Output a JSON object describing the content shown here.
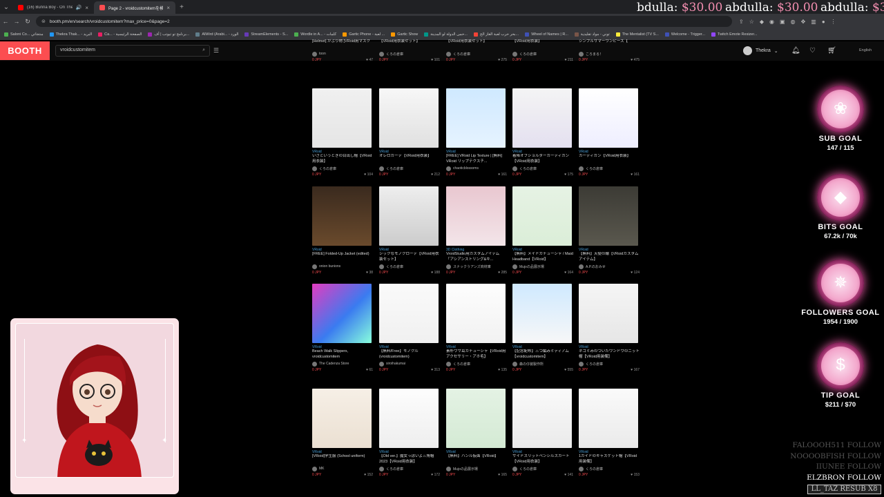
{
  "browser": {
    "tabs": [
      {
        "title": "(16) Bunna Boy - On The Le...",
        "favicon_color": "#ff0000"
      },
      {
        "title": "Page 2 - vroidcustomitemを検索...",
        "favicon_color": "#fc4d50"
      }
    ],
    "url": "booth.pm/en/search/vroidcustomitem?max_price=0&page=2",
    "bookmarks": [
      "Saloni Co... منتجاتي",
      "Thekra Thak... - البريد",
      "Ca... - الصفحة الرئيسية",
      "برنامج تو تيوتب | أف...",
      "AlWird (Arabi... - الورد",
      "StreamElements - S...",
      "Wordle in A... - كلمات",
      "Gartic Phone - لعبة ...",
      "Gartic Show",
      "حمى الدولة لو المدينة...",
      "بحر حرب لعبة الغاز الح...",
      "Wheel of Names | R...",
      "توني - مواد تقليدية",
      "The Mentalist (TV S...",
      "Welcome - Trigger...",
      "Twitch Emote Resizer..."
    ]
  },
  "booth": {
    "logo": "BOOTH",
    "search_value": "vroidcustomitem",
    "user_name": "Thekra",
    "language": "English"
  },
  "products": [
    {
      "cat": "",
      "title": "[Helmet] かぶり物 [VRoid用マスク",
      "shop": "toon",
      "price": "0 JPY",
      "likes": "47"
    },
    {
      "cat": "",
      "title": "【VRoid用衣装セット】",
      "shop": "くろの倉庫",
      "price": "0 JPY",
      "likes": "101"
    },
    {
      "cat": "",
      "title": "【VRoid用衣装セット】",
      "shop": "くろの倉庫",
      "price": "0 JPY",
      "likes": "275"
    },
    {
      "cat": "",
      "title": "【VRoid用衣装】",
      "shop": "くろの倉庫",
      "price": "0 JPY",
      "likes": "211"
    },
    {
      "cat": "",
      "title": "シンプルサマーワンピース【",
      "shop": "ころまる！",
      "price": "0 JPY",
      "likes": "475"
    },
    {
      "cat": "VRoid",
      "title": "いざというときの目出し帽【VRoid用衣装】",
      "shop": "くろの倉庫",
      "price": "0 JPY",
      "likes": "104"
    },
    {
      "cat": "VRoid",
      "title": "オレロカーデ【VRoid用衣装】",
      "shop": "くろの倉庫",
      "price": "0 JPY",
      "likes": "212"
    },
    {
      "cat": "VRoid",
      "title": "[FREE] VRoid Lip Texture | [無料] VRoid リップテクスチ...",
      "shop": "chaoticblossoms",
      "price": "0 JPY",
      "likes": "161"
    },
    {
      "cat": "VRoid",
      "title": "着降オフショルダーカーディガン【VRoid用衣装】",
      "shop": "くろの倉庫",
      "price": "0 JPY",
      "likes": "175"
    },
    {
      "cat": "VRoid",
      "title": "カーディガン【VRoid用衣装】",
      "shop": "くろの倉庫",
      "price": "0 JPY",
      "likes": "161"
    },
    {
      "cat": "VRoid",
      "title": "[FREE] Folded-Up Jacket (edited)",
      "shop": "onion bunions",
      "price": "0 JPY",
      "likes": "38"
    },
    {
      "cat": "VRoid",
      "title": "シックなモノクローデ【VRoid用衣装セット】",
      "shop": "くろの倉庫",
      "price": "0 JPY",
      "likes": "188"
    },
    {
      "cat": "3D Clothing",
      "title": "VroidStudio用カスタムアイテム「アシアンストリング&キ...",
      "shop": "スナックうアンズ商材庫",
      "price": "0 JPY",
      "likes": "285"
    },
    {
      "cat": "VRoid",
      "title": "【無料】メイドカチューシャ / Maid Headband【VRoid】",
      "shop": "Mujoの品展示場",
      "price": "0 JPY",
      "likes": "164"
    },
    {
      "cat": "VRoid",
      "title": "【無料】天使の輪【VRoidカスタムアイテム】",
      "shop": "A.P.のおみせ",
      "price": "0 JPY",
      "likes": "124"
    },
    {
      "cat": "VRoid",
      "title": "Beach Walk Slippers, vroidcustomitem",
      "shop": "The Cadenza Store",
      "price": "0 JPY",
      "likes": "61"
    },
    {
      "cat": "VRoid",
      "title": "【無料/Free】モノクル (vroidcustomitem)",
      "shop": "siroihakumai",
      "price": "0 JPY",
      "likes": "313"
    },
    {
      "cat": "VRoid",
      "title": "素朴ウサ耳カチューシャ【VRoid用アクセサリー・アホ毛】",
      "shop": "くろの倉庫",
      "price": "0 JPY",
      "likes": "135"
    },
    {
      "cat": "VRoid",
      "title": "【記念配布】三つ編みミディアム【vroidcustomitem】",
      "shop": "森の仔装製作所",
      "price": "0 JPY",
      "likes": "555"
    },
    {
      "cat": "VRoid",
      "title": "ネコミみのついたワンドウのニット帽【VRoid用装備】",
      "shop": "くろの倉庫",
      "price": "0 JPY",
      "likes": "167"
    },
    {
      "cat": "VRoid",
      "title": "[VRoid]学生服 (School uniform)",
      "shop": "MK",
      "price": "0 JPY",
      "likes": "152"
    },
    {
      "cat": "VRoid",
      "title": "【Old ver.】魔女っぽいよ三角帽 2023【VRoid用衣装】",
      "shop": "くろの倉庫",
      "price": "0 JPY",
      "likes": "172"
    },
    {
      "cat": "VRoid",
      "title": "【無料】ハンル仮面【VRoid】",
      "shop": "Mujoの品展示場",
      "price": "0 JPY",
      "likes": "165"
    },
    {
      "cat": "VRoid",
      "title": "サイドスリットペンシルスカート【VRoid用衣装】",
      "shop": "くろの倉庫",
      "price": "0 JPY",
      "likes": "141"
    },
    {
      "cat": "VRoid",
      "title": "1ガイドのキャスケット帽【VRoid用装備】",
      "shop": "くろの倉庫",
      "price": "0 JPY",
      "likes": "153"
    }
  ],
  "overlay": {
    "donors": [
      {
        "name": "bdulla:",
        "amount": "$30.00"
      },
      {
        "name": "abdulla:",
        "amount": "$30.00"
      },
      {
        "name": "abdulla:",
        "amount": "$3"
      }
    ],
    "goals": [
      {
        "label": "SUB GOAL",
        "progress": "147 / 115",
        "symbol": "❀"
      },
      {
        "label": "BITS GOAL",
        "progress": "67.2k / 70k",
        "symbol": "◆"
      },
      {
        "label": "FOLLOWERS GOAL",
        "progress": "1954 / 1900",
        "symbol": "✵"
      },
      {
        "label": "TIP GOAL",
        "progress": "$211 / $70",
        "symbol": "$"
      }
    ],
    "followers": [
      "FALOOOH511 FOLLOW",
      "NOOOOBFISH FOLLOW",
      "IIUNEE FOLLOW",
      "ELZBRON FOLLOW"
    ],
    "resub": "LL_TAZ RESUB X8",
    "accent": "#e85aa4",
    "booth_brand": "#fc4d50"
  }
}
